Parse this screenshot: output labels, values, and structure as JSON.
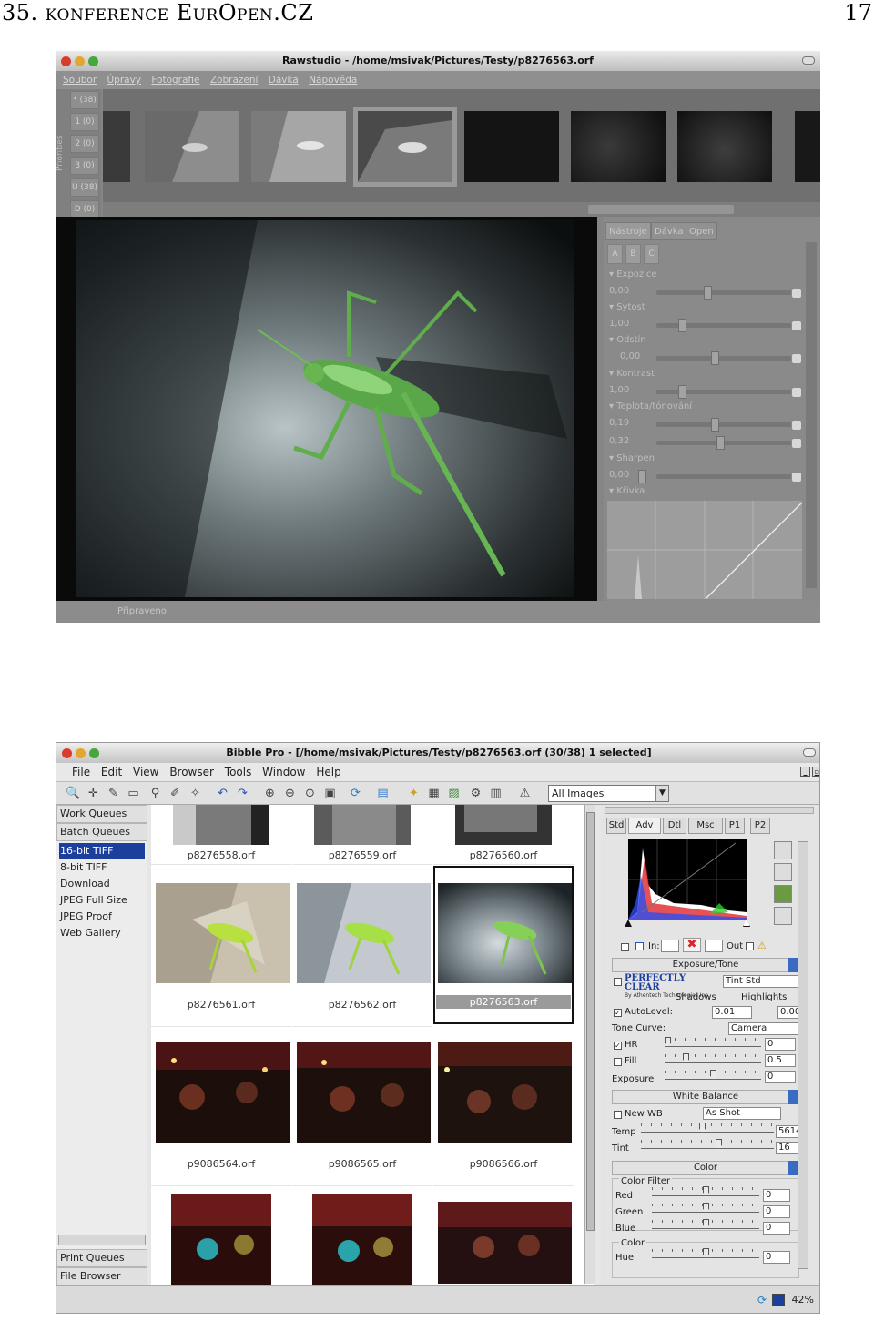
{
  "header": {
    "section": "35. konference EurOpen.CZ",
    "page": "17"
  },
  "rawstudio": {
    "title": "Rawstudio - /home/msivak/Pictures/Testy/p8276563.orf",
    "menu": [
      "Soubor",
      "Úpravy",
      "Fotografie",
      "Zobrazení",
      "Dávka",
      "Nápověda"
    ],
    "priorities_label": "Priorities",
    "priorities": [
      "* (38)",
      "1 (0)",
      "2 (0)",
      "3 (0)",
      "U (38)",
      "D (0)"
    ],
    "tabs": [
      "Nástroje",
      "Dávka",
      "Open"
    ],
    "abc": [
      "A",
      "B",
      "C"
    ],
    "tools": [
      {
        "name": "Expozice",
        "values": [
          "0,00"
        ]
      },
      {
        "name": "Sytost",
        "values": [
          "1,00"
        ]
      },
      {
        "name": "Odstín",
        "values": [
          "0,00"
        ]
      },
      {
        "name": "Kontrast",
        "values": [
          "1,00"
        ]
      },
      {
        "name": "Teplota/tónování",
        "values": [
          "0,19",
          "0,32"
        ]
      },
      {
        "name": "Sharpen",
        "values": [
          "0,00"
        ]
      },
      {
        "name": "Křivka",
        "values": []
      }
    ],
    "status": "Připraveno"
  },
  "bibble": {
    "title": "Bibble Pro - [/home/msivak/Pictures/Testy/p8276563.orf (30/38) 1 selected]",
    "menu": [
      "File",
      "Edit",
      "View",
      "Browser",
      "Tools",
      "Window",
      "Help"
    ],
    "filter": "All Images",
    "queues": {
      "work": "Work Queues",
      "batch": "Batch Queues",
      "items": [
        "16-bit TIFF",
        "8-bit TIFF",
        "Download",
        "JPEG Full Size",
        "JPEG Proof",
        "Web Gallery"
      ],
      "print": "Print Queues",
      "browser": "File Browser"
    },
    "files": [
      "p8276558.orf",
      "p8276559.orf",
      "p8276560.orf",
      "p8276561.orf",
      "p8276562.orf",
      "p8276563.orf",
      "p9086564.orf",
      "p9086565.orf",
      "p9086566.orf"
    ],
    "right_tabs": [
      "Std",
      "Adv",
      "Dtl",
      "Msc",
      "P1",
      "P2"
    ],
    "in_label": "In:",
    "out_label": "Out",
    "exposure_tone": "Exposure/Tone",
    "perfectly_clear": "PERFECTLY CLEAR",
    "perfectly_clear_sub": "By Athentech Technologies Inc.",
    "tint_std": "Tint Std",
    "shadows": "Shadows",
    "highlights": "Highlights",
    "autolevel": "AutoLevel:",
    "autolevel_v1": "0.01",
    "autolevel_v2": "0.007",
    "tone_curve": "Tone Curve:",
    "tone_curve_v": "Camera",
    "hr": "HR",
    "hr_v": "0",
    "fill": "Fill",
    "fill_v": "0.5",
    "exposure": "Exposure",
    "exposure_v": "0",
    "white_balance": "White Balance",
    "new_wb": "New WB",
    "as_shot": "As Shot",
    "temp": "Temp",
    "temp_v": "5614",
    "tint": "Tint",
    "tint_v": "16",
    "color": "Color",
    "color_filter": "Color Filter",
    "red": "Red",
    "red_v": "0",
    "green": "Green",
    "green_v": "0",
    "blue": "Blue",
    "blue_v": "0",
    "color2": "Color",
    "hue": "Hue",
    "hue_v": "0",
    "zoom": "42%"
  }
}
